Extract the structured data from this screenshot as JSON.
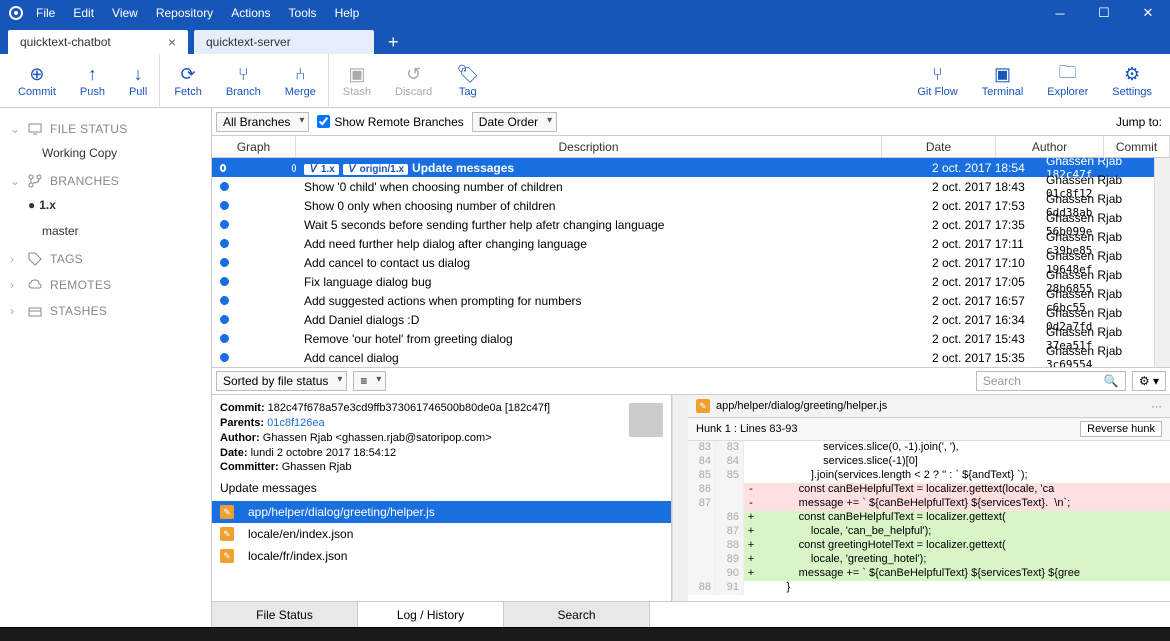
{
  "menu": [
    "File",
    "Edit",
    "View",
    "Repository",
    "Actions",
    "Tools",
    "Help"
  ],
  "tabs": [
    {
      "label": "quicktext-chatbot",
      "active": true
    },
    {
      "label": "quicktext-server",
      "active": false
    }
  ],
  "toolbar": [
    {
      "key": "commit",
      "label": "Commit"
    },
    {
      "key": "push",
      "label": "Push"
    },
    {
      "key": "pull",
      "label": "Pull"
    },
    {
      "key": "fetch",
      "label": "Fetch"
    },
    {
      "key": "branch",
      "label": "Branch"
    },
    {
      "key": "merge",
      "label": "Merge"
    },
    {
      "key": "stash",
      "label": "Stash",
      "dis": true
    },
    {
      "key": "discard",
      "label": "Discard",
      "dis": true
    },
    {
      "key": "tag",
      "label": "Tag"
    }
  ],
  "toolbar_right": [
    {
      "key": "gitflow",
      "label": "Git Flow"
    },
    {
      "key": "terminal",
      "label": "Terminal"
    },
    {
      "key": "explorer",
      "label": "Explorer"
    },
    {
      "key": "settings",
      "label": "Settings"
    }
  ],
  "sidebar": {
    "file_status": "FILE STATUS",
    "working_copy": "Working Copy",
    "branches": "BRANCHES",
    "branch_items": [
      "1.x",
      "master"
    ],
    "selected_branch": "1.x",
    "tags": "TAGS",
    "remotes": "REMOTES",
    "stashes": "STASHES"
  },
  "filter": {
    "all_branches": "All Branches",
    "show_remote": "Show Remote Branches",
    "date_order": "Date Order",
    "jump": "Jump to:"
  },
  "headers": {
    "graph": "Graph",
    "desc": "Description",
    "date": "Date",
    "author": "Author",
    "commit": "Commit"
  },
  "commits": [
    {
      "desc": "Update messages",
      "date": "2 oct. 2017 18:54",
      "author": "Ghassen Rjab <gha",
      "hash": "182c47f",
      "sel": true,
      "badges": [
        "1.x",
        "origin/1.x"
      ]
    },
    {
      "desc": "Show '0 child' when choosing number of children",
      "date": "2 oct. 2017 18:43",
      "author": "Ghassen Rjab <gha",
      "hash": "01c8f12"
    },
    {
      "desc": "Show 0 only when choosing number of children",
      "date": "2 oct. 2017 17:53",
      "author": "Ghassen Rjab <gha",
      "hash": "6dd38ab"
    },
    {
      "desc": "Wait 5 seconds before sending further help afetr changing language",
      "date": "2 oct. 2017 17:35",
      "author": "Ghassen Rjab <gha",
      "hash": "56b099e"
    },
    {
      "desc": "Add need further help dialog after changing language",
      "date": "2 oct. 2017 17:11",
      "author": "Ghassen Rjab <gha",
      "hash": "c39be85"
    },
    {
      "desc": "Add cancel to contact us dialog",
      "date": "2 oct. 2017 17:10",
      "author": "Ghassen Rjab <gha",
      "hash": "19648ef"
    },
    {
      "desc": "Fix language dialog bug",
      "date": "2 oct. 2017 17:05",
      "author": "Ghassen Rjab <gha",
      "hash": "28b6855"
    },
    {
      "desc": "Add suggested actions when prompting for numbers",
      "date": "2 oct. 2017 16:57",
      "author": "Ghassen Rjab <gha",
      "hash": "c6bc55"
    },
    {
      "desc": "Add Daniel dialogs :D",
      "date": "2 oct. 2017 16:34",
      "author": "Ghassen Rjab <gha",
      "hash": "0d2a7fd"
    },
    {
      "desc": "Remove 'our hotel' from greeting dialog",
      "date": "2 oct. 2017 15:43",
      "author": "Ghassen Rjab <gha",
      "hash": "37ea51f"
    },
    {
      "desc": "Add cancel dialog",
      "date": "2 oct. 2017 15:35",
      "author": "Ghassen Rjab <gha",
      "hash": "3c69554"
    }
  ],
  "sort_label": "Sorted by file status",
  "search_placeholder": "Search",
  "meta": {
    "commit_label": "Commit:",
    "commit": "182c47f678a57e3cd9ffb373061746500b80de0a [182c47f]",
    "parents_label": "Parents:",
    "parents": "01c8f126ea",
    "author_label": "Author:",
    "author": "Ghassen Rjab <ghassen.rjab@satoripop.com>",
    "date_label": "Date:",
    "date": "lundi 2 octobre 2017 18:54:12",
    "committer_label": "Committer:",
    "committer": "Ghassen Rjab",
    "message": "Update messages"
  },
  "files": [
    {
      "path": "app/helper/dialog/greeting/helper.js",
      "sel": true
    },
    {
      "path": "locale/en/index.json"
    },
    {
      "path": "locale/fr/index.json"
    }
  ],
  "diff": {
    "path": "app/helper/dialog/greeting/helper.js",
    "hunk": "Hunk 1 : Lines 83-93",
    "reverse": "Reverse hunk",
    "lines": [
      {
        "a": "83",
        "b": "83",
        "s": "",
        "t": "                    services.slice(0, -1).join(', '),"
      },
      {
        "a": "84",
        "b": "84",
        "s": "",
        "t": "                    services.slice(-1)[0]"
      },
      {
        "a": "85",
        "b": "85",
        "s": "",
        "t": "                ].join(services.length < 2 ? '' : ` ${andText} `);"
      },
      {
        "a": "86",
        "b": "",
        "s": "-",
        "t": "            const canBeHelpfulText = localizer.gettext(locale, 'ca",
        "cls": "del"
      },
      {
        "a": "87",
        "b": "",
        "s": "-",
        "t": "            message += ` ${canBeHelpfulText} ${servicesText}.  \\n`;",
        "cls": "del"
      },
      {
        "a": "",
        "b": "86",
        "s": "+",
        "t": "            const canBeHelpfulText = localizer.gettext(",
        "cls": "add"
      },
      {
        "a": "",
        "b": "87",
        "s": "+",
        "t": "                locale, 'can_be_helpful');",
        "cls": "add"
      },
      {
        "a": "",
        "b": "88",
        "s": "+",
        "t": "            const greetingHotelText = localizer.gettext(",
        "cls": "add"
      },
      {
        "a": "",
        "b": "89",
        "s": "+",
        "t": "                locale, 'greeting_hotel');",
        "cls": "add"
      },
      {
        "a": "",
        "b": "90",
        "s": "+",
        "t": "            message += ` ${canBeHelpfulText} ${servicesText} ${gree",
        "cls": "add"
      },
      {
        "a": "88",
        "b": "91",
        "s": "",
        "t": "        }"
      }
    ]
  },
  "bottom_tabs": [
    "File Status",
    "Log / History",
    "Search"
  ],
  "bottom_active": 1
}
